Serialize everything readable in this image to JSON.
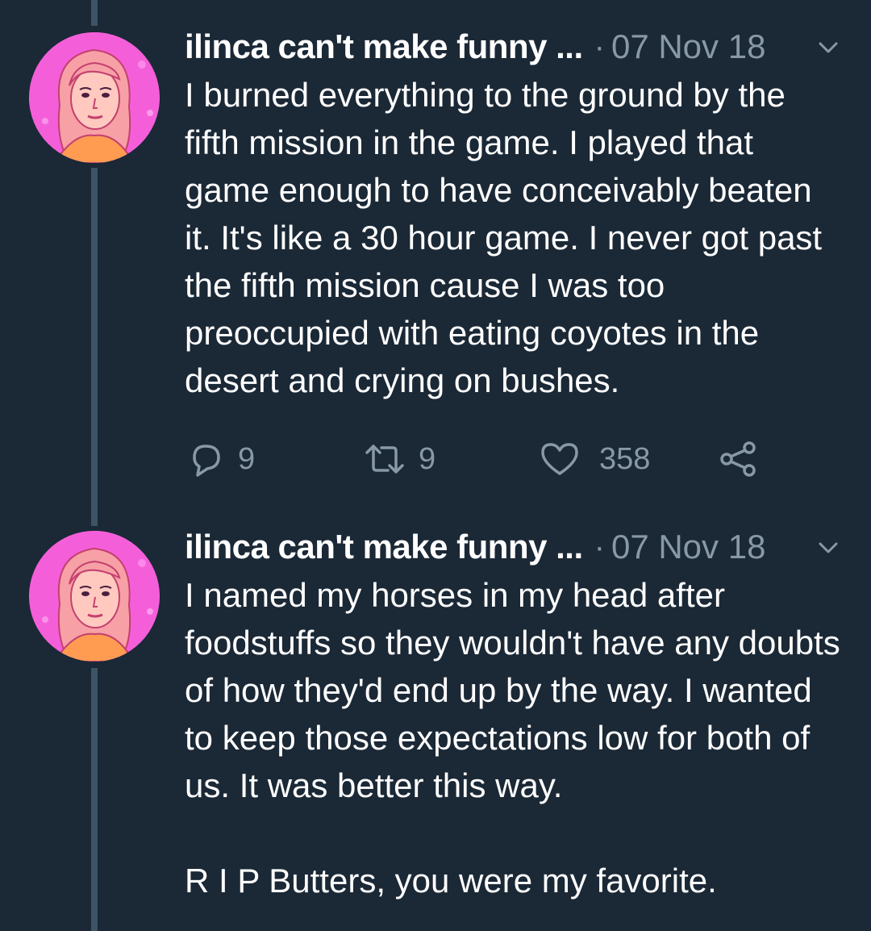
{
  "tweets": [
    {
      "display_name": "ilinca can't make funny ...",
      "separator": "·",
      "date": "07 Nov 18",
      "paragraphs": [
        "I burned everything to the ground by the fifth mission in the game. I played that game enough to have conceivably beaten it. It's like a 30 hour game. I never got past the fifth mission cause I was too preoccupied with eating coyotes in the desert and crying on bushes."
      ],
      "reply_count": "9",
      "retweet_count": "9",
      "like_count": "358"
    },
    {
      "display_name": "ilinca can't make funny ...",
      "separator": "·",
      "date": "07 Nov 18",
      "paragraphs": [
        "I named my horses in my head after foodstuffs so they wouldn't have any doubts of how they'd end up by the way. I wanted to keep those expectations low for both of us. It was better this way.",
        "R I P Butters, you were my favorite."
      ]
    }
  ],
  "icons": {
    "reply": "reply-icon",
    "retweet": "retweet-icon",
    "like": "heart-icon",
    "share": "share-icon",
    "more": "chevron-down-icon",
    "avatar": "avatar-illustration"
  },
  "colors": {
    "background": "#1b2836",
    "text": "#ffffff",
    "secondary": "#8899a6",
    "thread_line": "#3d5366",
    "avatar_bg": "#f45fd9"
  }
}
